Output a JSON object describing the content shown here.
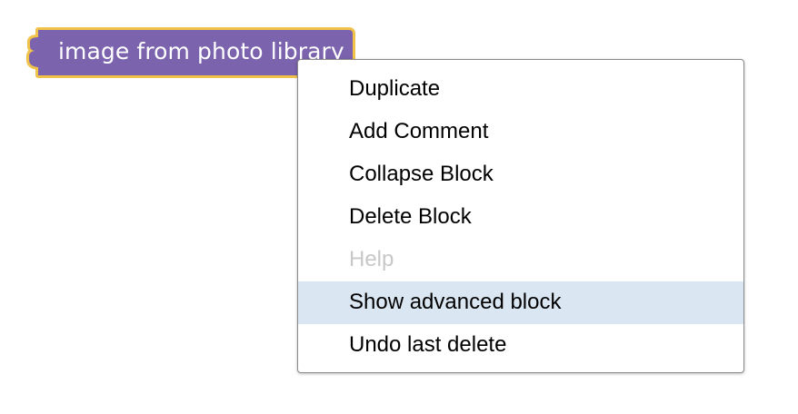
{
  "block": {
    "label": "image from photo library",
    "fill_color": "#7b63ad",
    "outline_color": "#f1c24a"
  },
  "context_menu": {
    "items": [
      {
        "label": "Duplicate",
        "enabled": true,
        "highlighted": false
      },
      {
        "label": "Add Comment",
        "enabled": true,
        "highlighted": false
      },
      {
        "label": "Collapse Block",
        "enabled": true,
        "highlighted": false
      },
      {
        "label": "Delete Block",
        "enabled": true,
        "highlighted": false
      },
      {
        "label": "Help",
        "enabled": false,
        "highlighted": false
      },
      {
        "label": "Show advanced block",
        "enabled": true,
        "highlighted": true
      },
      {
        "label": "Undo last delete",
        "enabled": true,
        "highlighted": false
      }
    ],
    "highlight_color": "#dbe6f3",
    "disabled_text_color": "#c8c8c8"
  }
}
